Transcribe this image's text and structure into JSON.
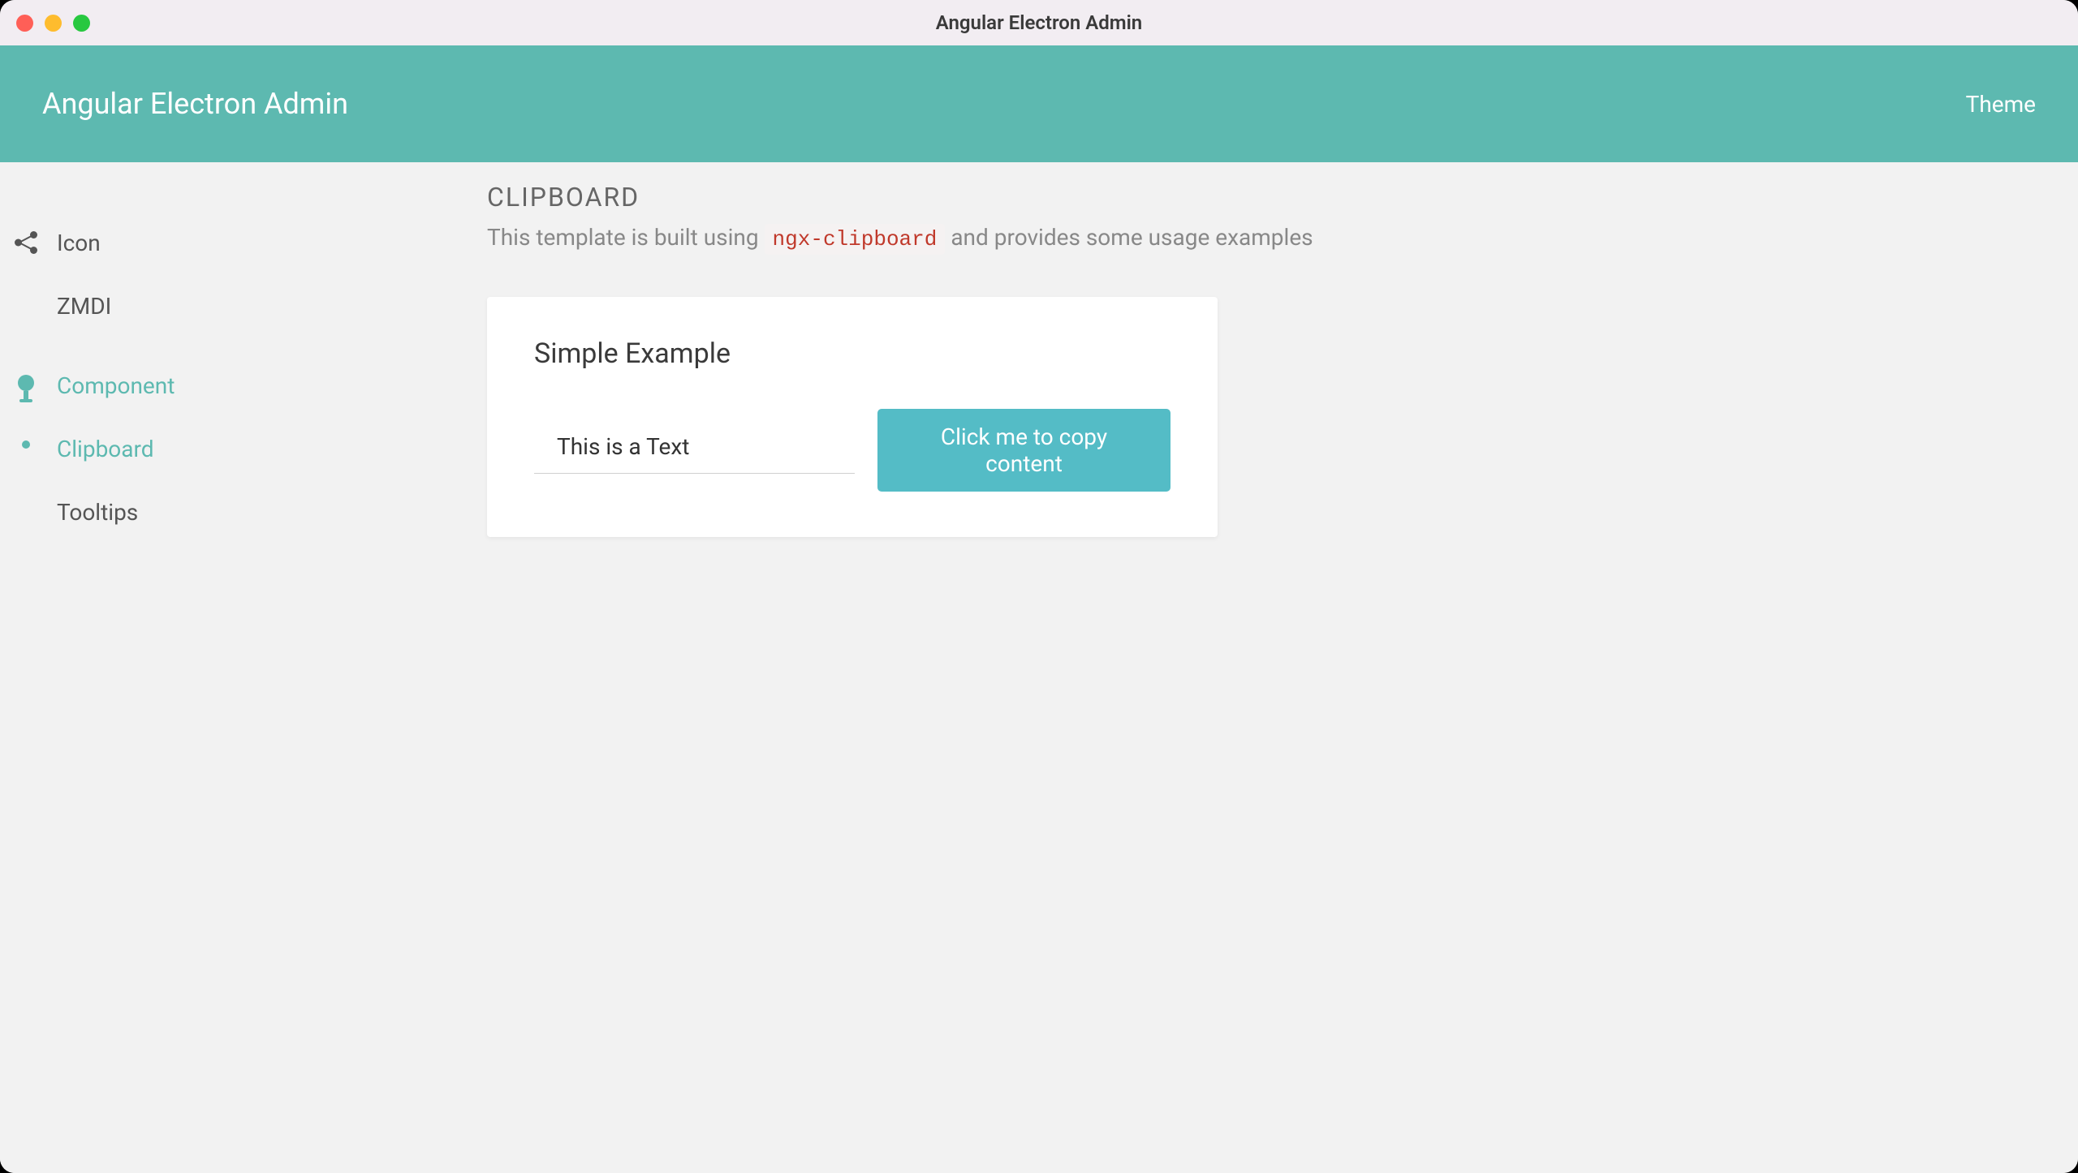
{
  "window": {
    "title": "Angular Electron Admin"
  },
  "header": {
    "title": "Angular Electron Admin",
    "theme_label": "Theme"
  },
  "sidebar": {
    "items": [
      {
        "label": "Icon"
      },
      {
        "label": "ZMDI"
      },
      {
        "label": "Component"
      },
      {
        "label": "Clipboard"
      },
      {
        "label": "Tooltips"
      }
    ]
  },
  "main": {
    "page_title": "CLIPBOARD",
    "desc_prefix": "This template is built using ",
    "desc_code": "ngx-clipboard",
    "desc_suffix": " and provides some usage examples",
    "card": {
      "title": "Simple Example",
      "input_value": "This is a Text",
      "button_label": "Click me to copy content"
    }
  },
  "colors": {
    "accent": "#5db9b0",
    "button": "#54bcc6"
  }
}
